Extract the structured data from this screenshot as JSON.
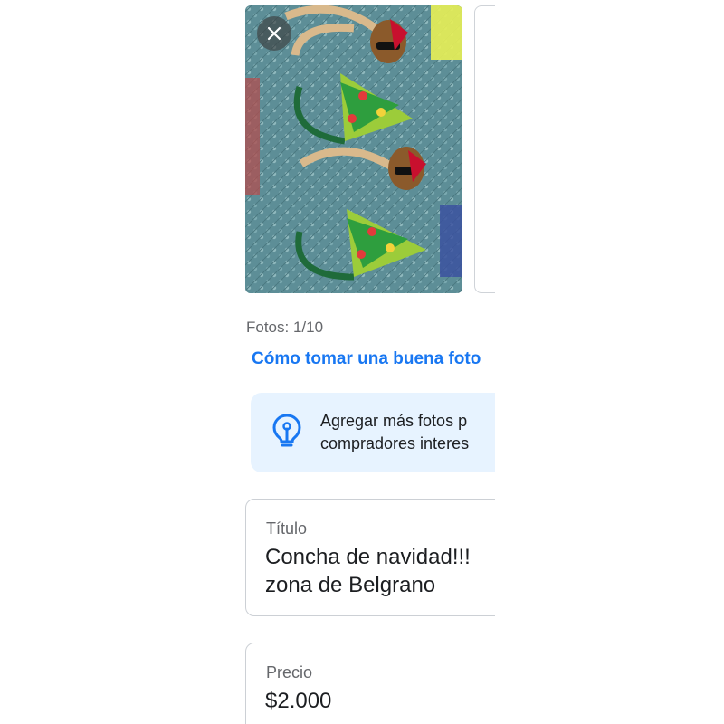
{
  "photos": {
    "count_label": "Fotos: 1/10",
    "main_photo_description": "headbands"
  },
  "help": {
    "link_label": "Cómo tomar una buena foto"
  },
  "tip": {
    "icon": "lightbulb-icon",
    "line1": "Agregar más fotos p",
    "line2": "compradores interes"
  },
  "title_field": {
    "label": "Título",
    "value_line1": "Concha de navidad!!!",
    "value_line2": "zona de Belgrano"
  },
  "price_field": {
    "label": "Precio",
    "value": "$2.000"
  },
  "colors": {
    "accent": "#1877f2",
    "tip_bg": "#e7f3ff"
  }
}
